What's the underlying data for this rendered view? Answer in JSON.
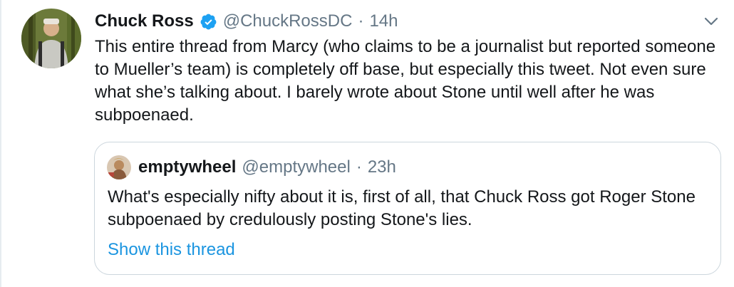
{
  "tweet": {
    "author_name": "Chuck Ross",
    "author_handle": "@ChuckRossDC",
    "separator": "·",
    "timestamp": "14h",
    "verified": true,
    "text": "This entire thread from Marcy (who claims to be a journalist but reported someone to Mueller’s team) is completely off base, but especially this tweet. Not even sure what she’s talking about. I barely wrote about Stone until well after he was subpoenaed.",
    "avatar_icon": "user-avatar-photo",
    "caret_icon": "chevron-down-icon"
  },
  "quote": {
    "author_name": "emptywheel",
    "author_handle": "@emptywheel",
    "separator": "·",
    "timestamp": "23h",
    "text": "What's especially nifty about it is, first of all, that Chuck Ross got Roger Stone subpoenaed by credulously posting Stone's lies.",
    "show_thread_label": "Show this thread",
    "avatar_icon": "user-avatar-photo"
  },
  "colors": {
    "text_primary": "#14171a",
    "text_secondary": "#657786",
    "link": "#1b95e0",
    "verified": "#1da1f2",
    "border": "#ccd6dd"
  }
}
